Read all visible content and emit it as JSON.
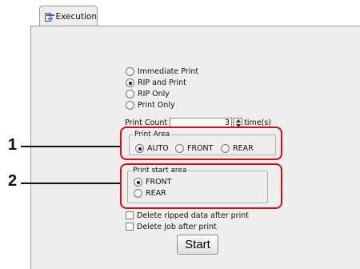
{
  "tab": {
    "label": "Execution",
    "icon": "execution-window-icon"
  },
  "print_mode": {
    "options": [
      {
        "label": "Immediate Print",
        "selected": false
      },
      {
        "label": "RIP and Print",
        "selected": true
      },
      {
        "label": "RIP Only",
        "selected": false
      },
      {
        "label": "Print Only",
        "selected": false
      }
    ]
  },
  "print_count": {
    "label": "Print Count",
    "value": "3",
    "unit": "time(s)"
  },
  "print_area": {
    "legend": "Print   Area",
    "options": [
      {
        "label": "AUTO",
        "selected": true
      },
      {
        "label": "FRONT",
        "selected": false
      },
      {
        "label": "REAR",
        "selected": false
      }
    ]
  },
  "print_start_area": {
    "legend": "Print start area",
    "options": [
      {
        "label": "FRONT",
        "selected": true
      },
      {
        "label": "REAR",
        "selected": false
      }
    ]
  },
  "checkboxes": [
    {
      "label": "Delete ripped data after print",
      "checked": false
    },
    {
      "label": "Delete Job after print",
      "checked": false
    }
  ],
  "start_button": {
    "label": "Start"
  },
  "callouts": [
    {
      "number": "1"
    },
    {
      "number": "2"
    }
  ],
  "colors": {
    "callout_border": "#d0101a",
    "panel_bg": "#eeeeee"
  }
}
